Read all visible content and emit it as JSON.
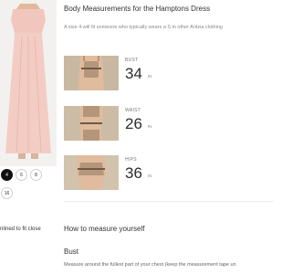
{
  "product": {
    "sizes": [
      "4",
      "6",
      "8",
      "16"
    ],
    "selected_size": "4",
    "fit_note": "nlined to fit close"
  },
  "measurements": {
    "title": "Body Measurements for the Hamptons Dress",
    "subtitle": "A size 4 will fit someone who typically wears a S in other Aritzia clothing",
    "rows": [
      {
        "label": "BUST",
        "value": "34",
        "unit": "IN"
      },
      {
        "label": "WAIST",
        "value": "26",
        "unit": "IN"
      },
      {
        "label": "HIPS",
        "value": "36",
        "unit": "IN"
      }
    ]
  },
  "how_to": {
    "title": "How to measure yourself",
    "bust_heading": "Bust",
    "bust_text": "Measure around the fullest part of your chest (keep the measurement tape un"
  },
  "colors": {
    "dress": "#f3cdc4",
    "skin": "#e2b99a",
    "selected_chip": "#111111"
  }
}
